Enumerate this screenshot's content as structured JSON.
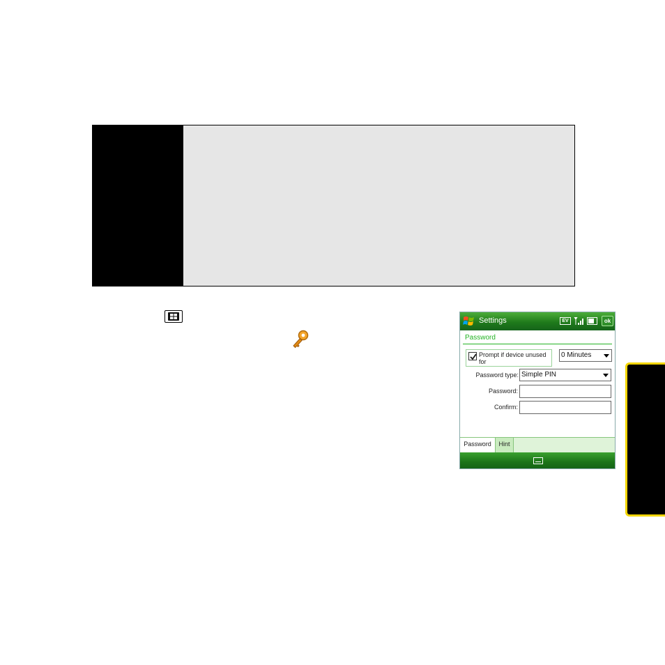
{
  "phone": {
    "titlebar": {
      "title": "Settings",
      "status_ev": "EV",
      "ok_label": "ok"
    },
    "section_title": "Password",
    "prompt": {
      "checked": true,
      "label": "Prompt if device unused for",
      "duration": "0 Minutes"
    },
    "password_type": {
      "label": "Password type:",
      "value": "Simple PIN"
    },
    "password_field": {
      "label": "Password:",
      "value": ""
    },
    "confirm_field": {
      "label": "Confirm:",
      "value": ""
    },
    "tabs": [
      {
        "label": "Password",
        "active": true
      },
      {
        "label": "Hint",
        "active": false
      }
    ]
  },
  "colors": {
    "titlebar_green": "#1f7a1b",
    "section_green": "#22b322",
    "callout_bg": "#e6e6e6",
    "side_tab_border": "#f2d500"
  },
  "icons": {
    "start": "windows-start-icon",
    "settings_key": "key-icon",
    "keyboard": "keyboard-icon"
  }
}
